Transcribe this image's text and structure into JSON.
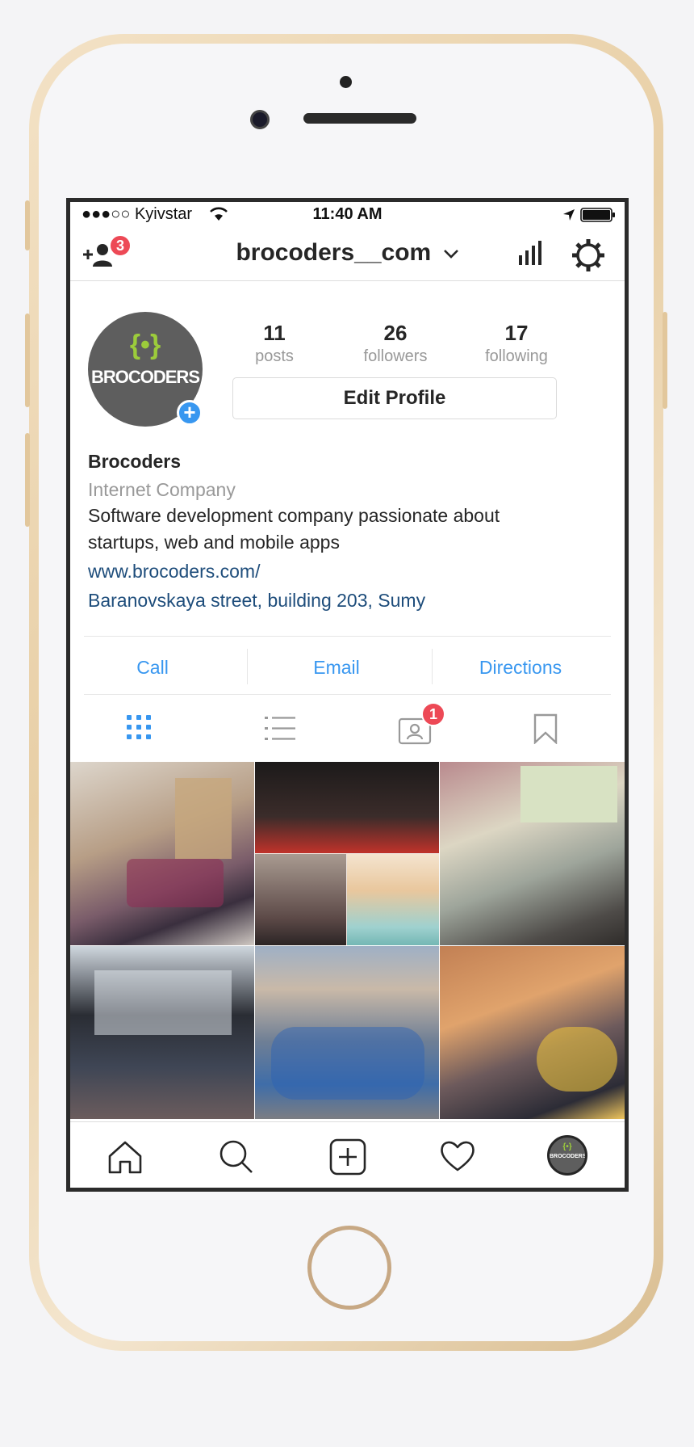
{
  "status_bar": {
    "carrier": "●●●○○ Kyivstar",
    "time": "11:40 AM"
  },
  "header": {
    "username": "brocoders__com",
    "notification_count": "3"
  },
  "profile": {
    "avatar_text": "BROCODERS",
    "avatar_symbol": "{•}",
    "stats": [
      {
        "value": "11",
        "label": "posts"
      },
      {
        "value": "26",
        "label": "followers"
      },
      {
        "value": "17",
        "label": "following"
      }
    ],
    "edit_button": "Edit Profile",
    "name": "Brocoders",
    "category": "Internet Company",
    "bio_line1": "Software development company passionate about",
    "bio_line2": "startups, web and mobile apps",
    "website": "www.brocoders.com/",
    "address": "Baranovskaya street, building 203, Sumy"
  },
  "actions": {
    "call": "Call",
    "email": "Email",
    "directions": "Directions"
  },
  "tabs": {
    "tagged_badge": "1"
  },
  "colors": {
    "accent": "#3897f0",
    "link": "#1e4d7b",
    "badge": "#ed4956",
    "logo_green": "#9ccc3b"
  },
  "icons": [
    "add-person-icon",
    "chevron-down-icon",
    "insights-icon",
    "settings-gear-icon",
    "grid-icon",
    "list-icon",
    "tagged-icon",
    "bookmark-icon",
    "home-icon",
    "search-icon",
    "new-post-icon",
    "heart-icon",
    "profile-avatar-icon"
  ],
  "nav": {
    "avatar_text": "BROCODERS"
  }
}
